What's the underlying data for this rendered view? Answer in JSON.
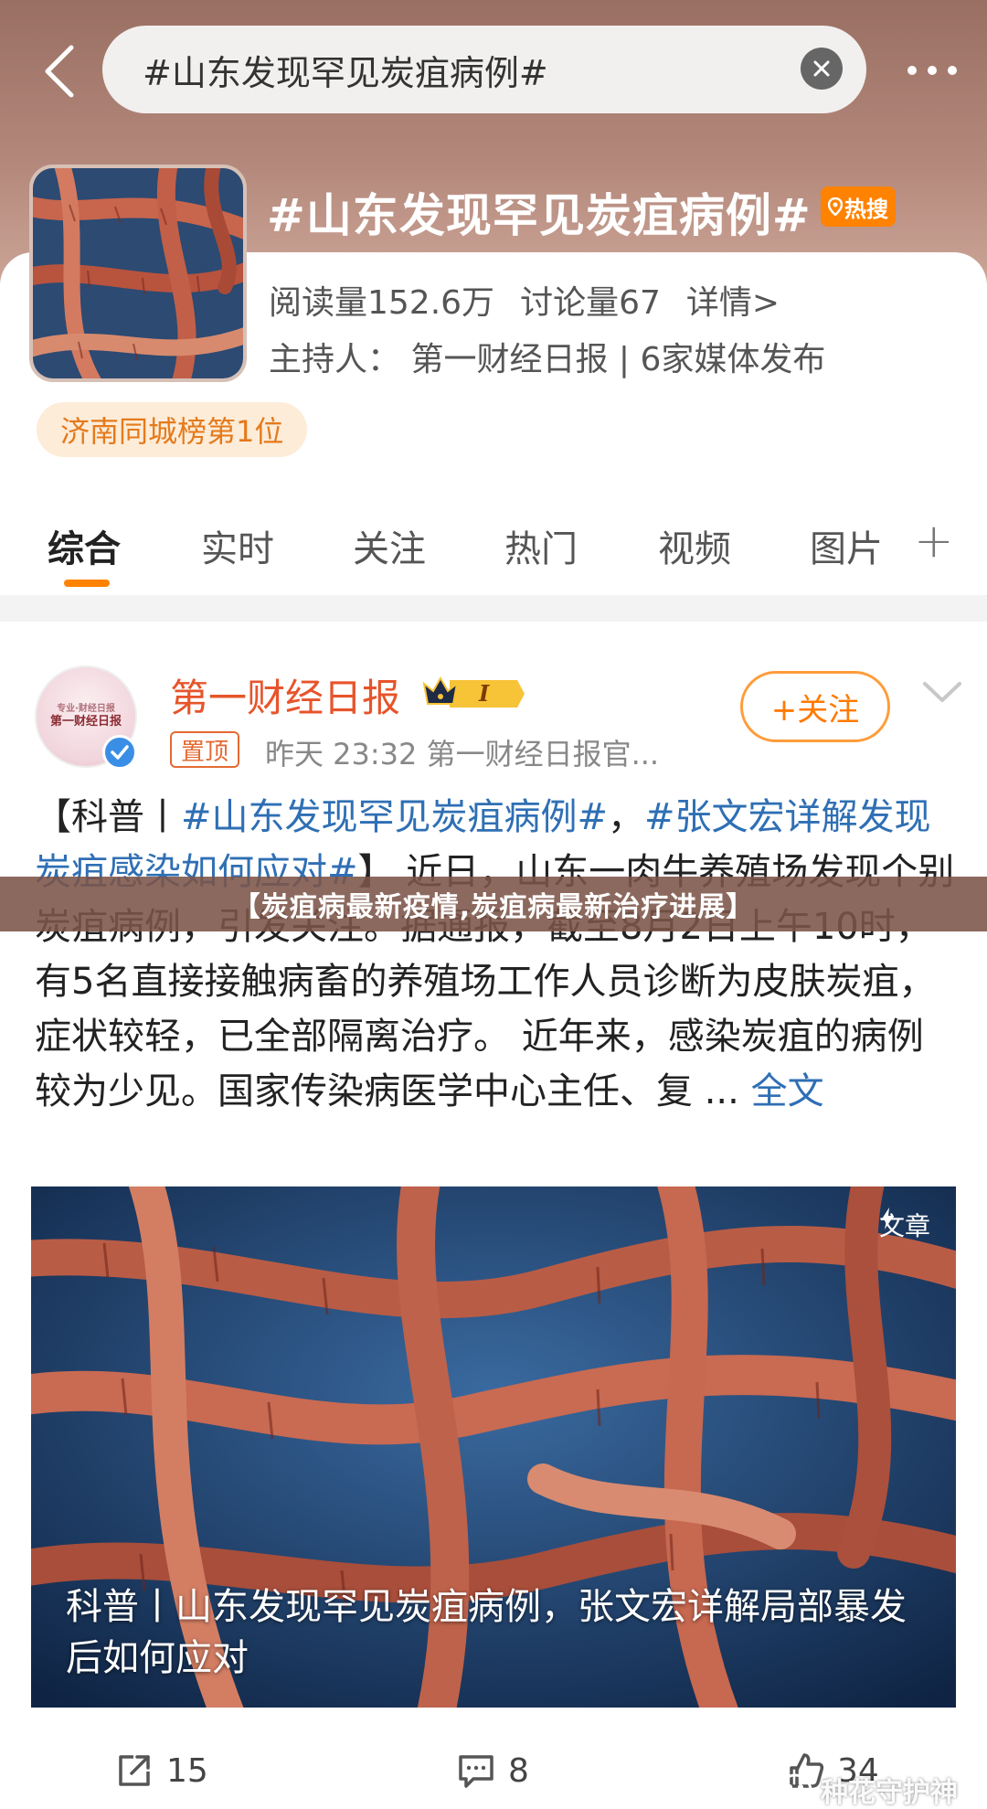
{
  "topbar": {
    "search_text": "#山东发现罕见炭疽病例#"
  },
  "topic": {
    "title": "#山东发现罕见炭疽病例#",
    "hot_badge": "热搜",
    "reads": "阅读量152.6万",
    "discussions": "讨论量67",
    "details_link": "详情>",
    "host": "主持人：  第一财经日报 | 6家媒体发布",
    "rank_badge": "济南同城榜第1位"
  },
  "tabs": [
    {
      "label": "综合",
      "active": true
    },
    {
      "label": "实时",
      "active": false
    },
    {
      "label": "关注",
      "active": false
    },
    {
      "label": "热门",
      "active": false
    },
    {
      "label": "视频",
      "active": false
    },
    {
      "label": "图片",
      "active": false
    }
  ],
  "tab_add": "+",
  "post": {
    "author": "第一财经日报",
    "vip_level": "I",
    "avatar_text_1": "专业·财经日报",
    "avatar_text_2": "第一财经日报",
    "pinned_label": "置顶",
    "meta": "昨天 23:32   第一财经日报官...",
    "follow_label": "+关注",
    "body_prefix": "【科普丨",
    "hashtag_1": "#山东发现罕见炭疽病例#",
    "sep": "，",
    "hashtag_2": "#张文宏详解发现炭疽感染如何应对#",
    "body_main": "】 近日，山东一肉牛养殖场发现个别炭疽病例，引发关注。据通报，截至8月2日上午10时，有5名直接接触病畜的养殖场工作人员诊断为皮肤炭疽，症状较轻，已全部隔离治疗。 近年来，感染炭疽的病例较为少见。国家传染病医学中心主任、复 ...",
    "full_text_link": "全文",
    "image_badge": "文章",
    "image_caption": "科普丨山东发现罕见炭疽病例，张文宏详解局部暴发后如何应对",
    "reposts": "15",
    "comments": "8",
    "likes": "34"
  },
  "overlay_title": "【炭疽病最新疫情,炭疽病最新治疗进展】",
  "watermark": "种花守护神",
  "colors": {
    "accent_orange": "#ff8200",
    "link_blue": "#2f6fb4",
    "author_red": "#e7542b"
  }
}
